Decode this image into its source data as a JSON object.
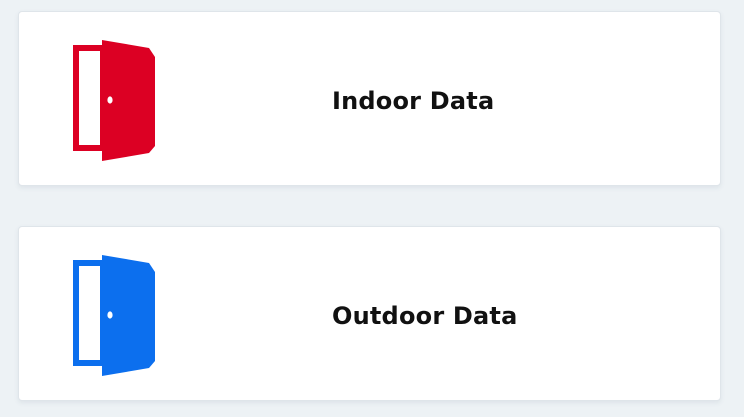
{
  "cards": [
    {
      "label": "Indoor Data",
      "icon": "door-open-icon",
      "icon_color": "#dc0023"
    },
    {
      "label": "Outdoor Data",
      "icon": "door-open-icon",
      "icon_color": "#0c6fee"
    }
  ],
  "page": {
    "background": "#edf2f5",
    "card_background": "#ffffff"
  }
}
